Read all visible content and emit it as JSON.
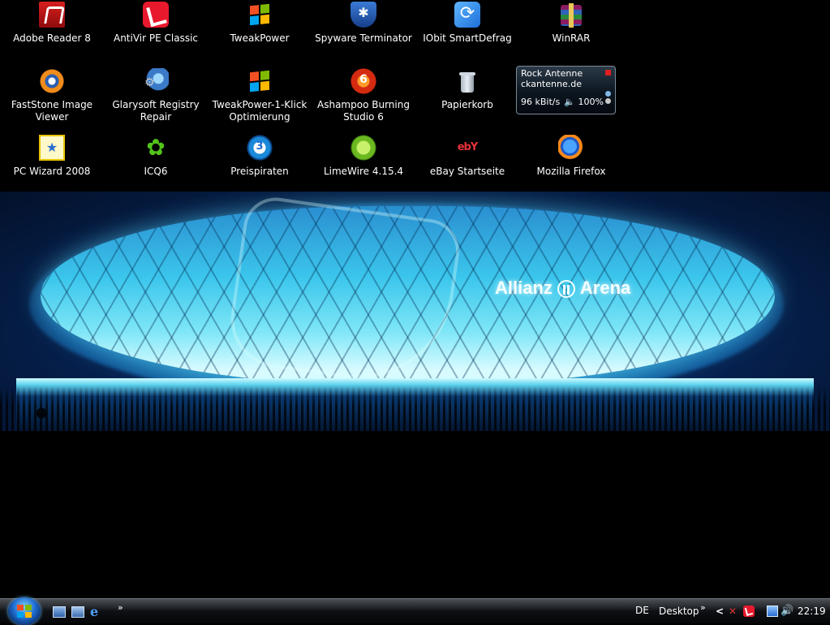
{
  "desktop": {
    "icons": [
      {
        "label": "Adobe Reader 8",
        "icon": "adobe-reader-icon"
      },
      {
        "label": "AntiVir PE Classic",
        "icon": "avira-umbrella-icon"
      },
      {
        "label": "TweakPower",
        "icon": "windows-flag-icon"
      },
      {
        "label": "Spyware Terminator",
        "icon": "shield-icon"
      },
      {
        "label": "IObit SmartDefrag",
        "icon": "defrag-icon"
      },
      {
        "label": "WinRAR",
        "icon": "winrar-books-icon"
      },
      {
        "label": "FastStone Image Viewer",
        "icon": "eye-icon"
      },
      {
        "label": "Glarysoft Registry Repair",
        "icon": "registry-repair-icon"
      },
      {
        "label": "TweakPower-1-Klick Optimierung",
        "icon": "windows-flag-icon"
      },
      {
        "label": "Ashampoo Burning Studio 6",
        "icon": "burning-disc-icon"
      },
      {
        "label": "Papierkorb",
        "icon": "recycle-bin-icon"
      },
      {
        "label": "PC Wizard 2008",
        "icon": "wizard-star-icon"
      },
      {
        "label": "ICQ6",
        "icon": "icq-flower-icon"
      },
      {
        "label": "Preispiraten",
        "icon": "preispiraten-icon"
      },
      {
        "label": "LimeWire 4.15.4",
        "icon": "limewire-icon"
      },
      {
        "label": "eBay Startseite",
        "icon": "ebay-icon"
      },
      {
        "label": "Mozilla Firefox",
        "icon": "firefox-icon"
      }
    ]
  },
  "wallpaper": {
    "text": "Allianz",
    "text2": "Arena"
  },
  "gadget": {
    "station": "Rock Antenne",
    "url": "ckantenne.de",
    "bitrate": "96 kBit/s",
    "volume": "100%",
    "icons": [
      "close-icon",
      "speaker-icon"
    ]
  },
  "taskbar": {
    "quicklaunch": [
      "show-desktop-icon",
      "switch-windows-icon",
      "internet-explorer-icon"
    ],
    "expand": "»",
    "language": "DE",
    "toolbar_label": "Desktop",
    "toolbar_expand": "»",
    "tray_expand": "<",
    "clock": "22:19"
  },
  "colors": {
    "background": "#000000",
    "taskbar": "#0e1014",
    "stadium_glow": "#3bc6ec"
  }
}
